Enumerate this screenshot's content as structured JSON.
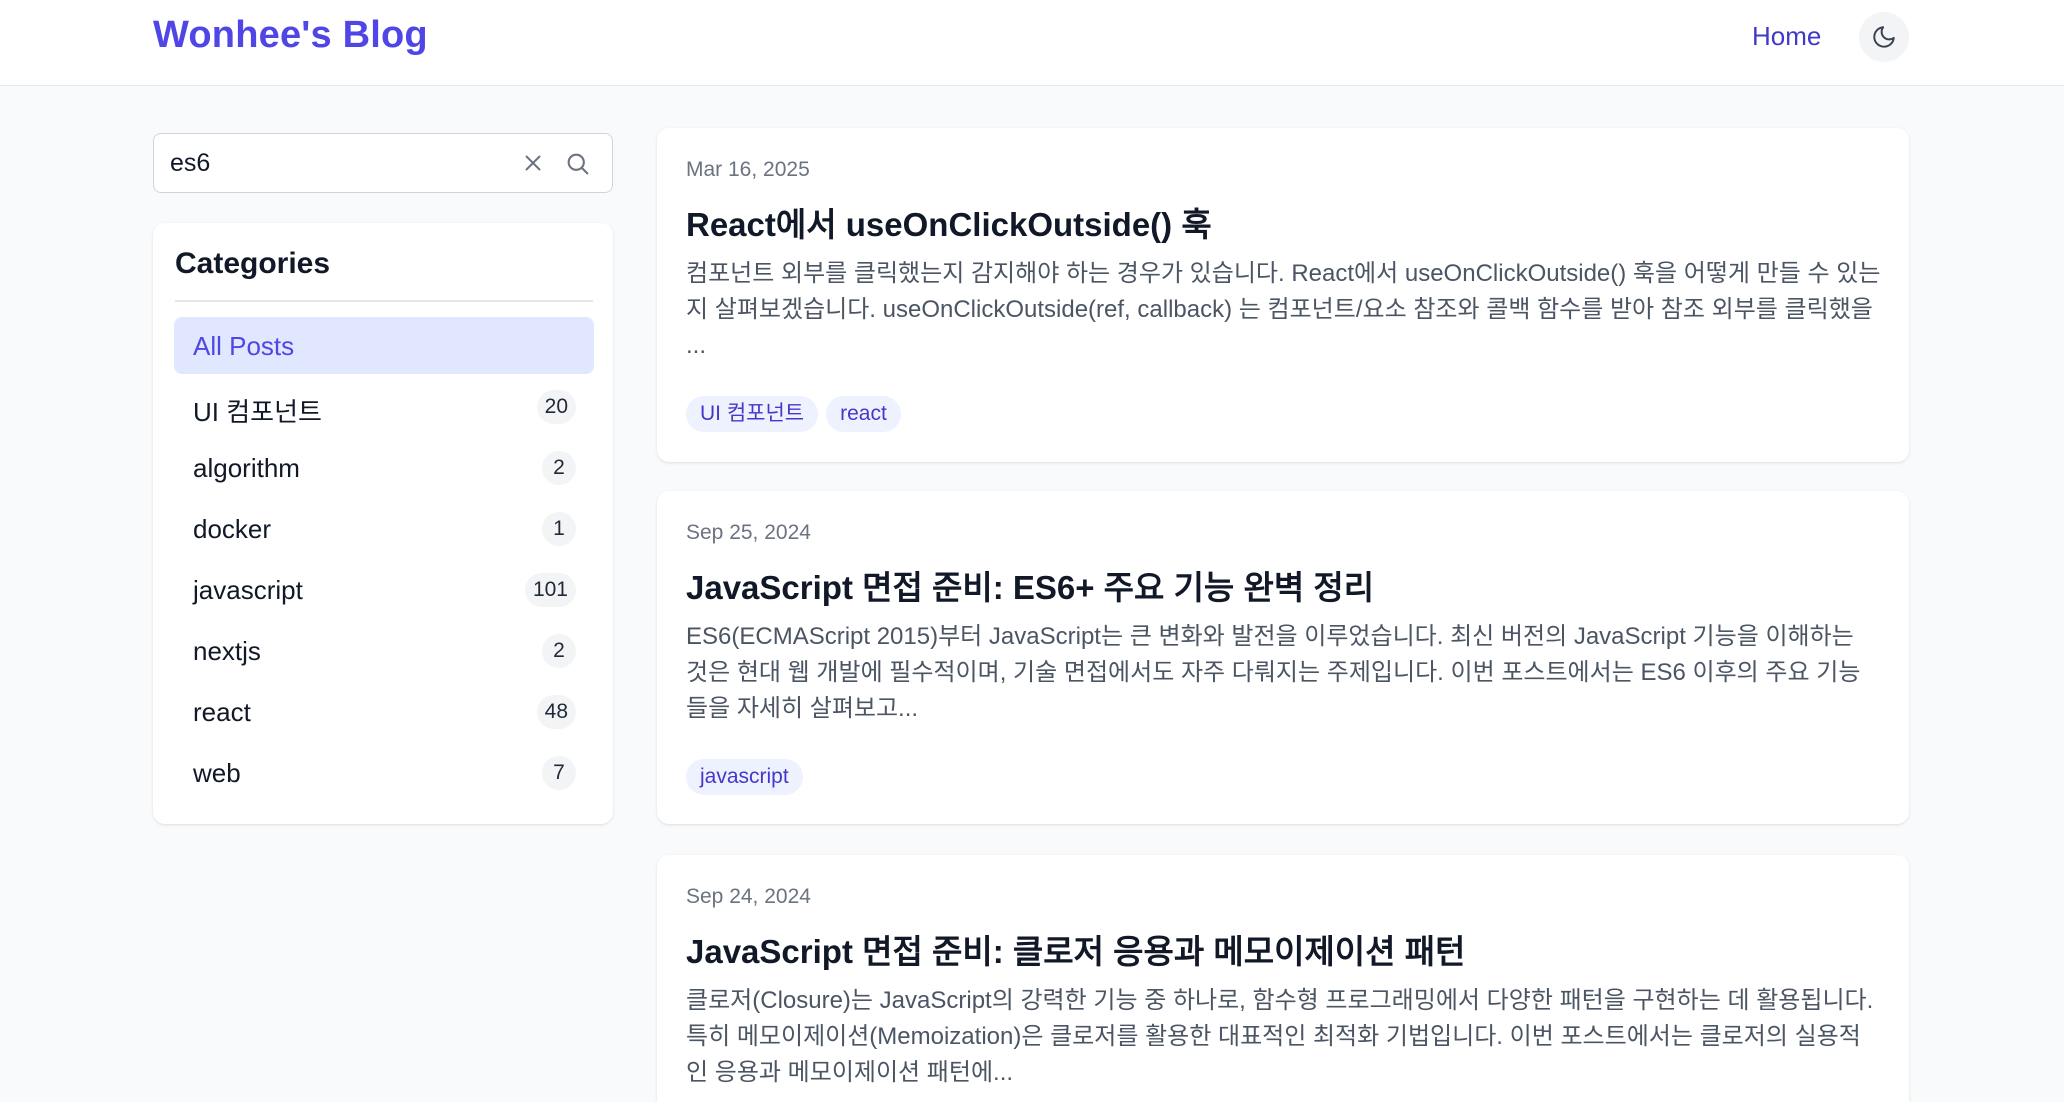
{
  "header": {
    "logo": "Wonhee's Blog",
    "nav_home": "Home",
    "theme_icon": "moon-icon"
  },
  "search": {
    "value": "es6",
    "placeholder": "",
    "clear_icon": "close-icon",
    "search_icon": "search-icon"
  },
  "categories": {
    "title": "Categories",
    "items": [
      {
        "label": "All Posts",
        "count": "",
        "active": true
      },
      {
        "label": "UI 컴포넌트",
        "count": "20"
      },
      {
        "label": "algorithm",
        "count": "2"
      },
      {
        "label": "docker",
        "count": "1"
      },
      {
        "label": "javascript",
        "count": "101"
      },
      {
        "label": "nextjs",
        "count": "2"
      },
      {
        "label": "react",
        "count": "48"
      },
      {
        "label": "web",
        "count": "7"
      }
    ]
  },
  "posts": [
    {
      "date": "Mar 16, 2025",
      "title": "React에서 useOnClickOutside() 훅",
      "excerpt": "컴포넌트 외부를 클릭했는지 감지해야 하는 경우가 있습니다. React에서 useOnClickOutside() 훅을 어떻게 만들 수 있는지 살펴보겠습니다. useOnClickOutside(ref, callback) 는 컴포넌트/요소 참조와 콜백 함수를 받아 참조 외부를 클릭했을 ...",
      "tags": [
        "UI 컴포넌트",
        "react"
      ]
    },
    {
      "date": "Sep 25, 2024",
      "title": "JavaScript 면접 준비: ES6+ 주요 기능 완벽 정리",
      "excerpt": "ES6(ECMAScript 2015)부터 JavaScript는 큰 변화와 발전을 이루었습니다. 최신 버전의 JavaScript 기능을 이해하는 것은 현대 웹 개발에 필수적이며, 기술 면접에서도 자주 다뤄지는 주제입니다. 이번 포스트에서는 ES6 이후의 주요 기능들을 자세히 살펴보고...",
      "tags": [
        "javascript"
      ]
    },
    {
      "date": "Sep 24, 2024",
      "title": "JavaScript 면접 준비: 클로저 응용과 메모이제이션 패턴",
      "excerpt": "클로저(Closure)는 JavaScript의 강력한 기능 중 하나로, 함수형 프로그래밍에서 다양한 패턴을 구현하는 데 활용됩니다. 특히 메모이제이션(Memoization)은 클로저를 활용한 대표적인 최적화 기법입니다. 이번 포스트에서는 클로저의 실용적인 응용과 메모이제이션 패턴에...",
      "tags": []
    }
  ],
  "colors": {
    "accent": "#4f46e5",
    "active_bg": "#e0e7ff",
    "tag_bg": "#eef2ff",
    "page_bg": "#f9fafb"
  }
}
